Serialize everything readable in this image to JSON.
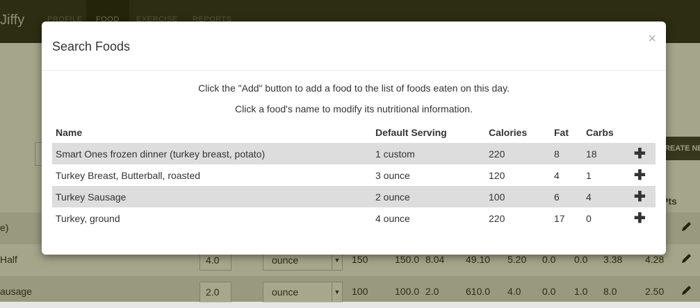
{
  "app": {
    "brand": "Jiffy",
    "nav_tabs": [
      "PROFILE",
      "FOOD",
      "EXERCISE",
      "REPORTS"
    ]
  },
  "background": {
    "create_button": "CREATE NEW",
    "column_label": "Pts",
    "rows": [
      {
        "name": "e)",
        "amount": "",
        "unit": "",
        "vals": []
      },
      {
        "name": "Half",
        "amount": "4.0",
        "unit": "ounce",
        "vals": [
          "150",
          "150.0",
          "8.04",
          "49.10",
          "5.20",
          "0.0",
          "0.0",
          "3.38",
          "4.28"
        ]
      },
      {
        "name": "ausage",
        "amount": "2.0",
        "unit": "ounce",
        "vals": [
          "100",
          "100.0",
          "2.0",
          "610.0",
          "4.0",
          "0.0",
          "1.0",
          "8.0",
          "2.50"
        ]
      }
    ]
  },
  "modal": {
    "title": "Search Foods",
    "close": "×",
    "instructions": [
      "Click the \"Add\" button to add a food to the list of foods eaten on this day.",
      "Click a food's name to modify its nutritional information."
    ],
    "columns": [
      "Name",
      "Default Serving",
      "Calories",
      "Fat",
      "Carbs"
    ],
    "add_symbol": "✚",
    "rows": [
      {
        "name": "Smart Ones frozen dinner (turkey breast, potato)",
        "serving": "1 custom",
        "calories": "220",
        "fat": "8",
        "carbs": "18"
      },
      {
        "name": "Turkey Breast, Butterball, roasted",
        "serving": "3 ounce",
        "calories": "120",
        "fat": "4",
        "carbs": "1"
      },
      {
        "name": "Turkey Sausage",
        "serving": "2 ounce",
        "calories": "100",
        "fat": "6",
        "carbs": "4"
      },
      {
        "name": "Turkey, ground",
        "serving": "4 ounce",
        "calories": "220",
        "fat": "17",
        "carbs": "0"
      }
    ]
  }
}
